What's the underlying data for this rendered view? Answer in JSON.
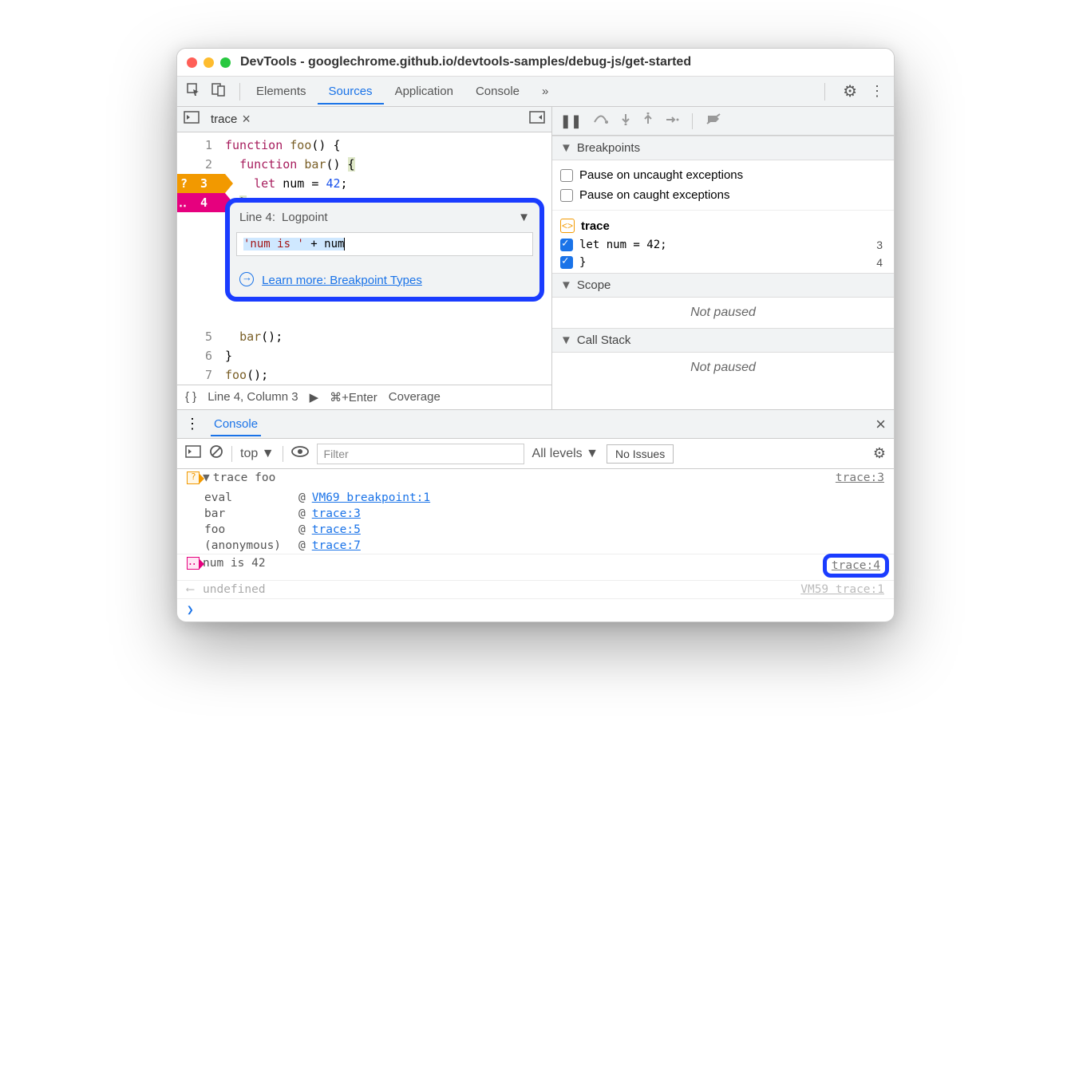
{
  "title": "DevTools - googlechrome.github.io/devtools-samples/debug-js/get-started",
  "tabs": {
    "t0": "Elements",
    "t1": "Sources",
    "t2": "Application",
    "t3": "Console"
  },
  "file_tab": "trace",
  "code": {
    "l1": "function foo() {",
    "l2": "  function bar() {",
    "l3": "    let num = 42;",
    "l4": "  }",
    "l5": "  bar();",
    "l6": "}",
    "l7": "foo();"
  },
  "ln": {
    "n1": "1",
    "n2": "2",
    "n3": "3",
    "n4": "4",
    "n5": "5",
    "n6": "6",
    "n7": "7"
  },
  "popover": {
    "line_label": "Line 4:",
    "type": "Logpoint",
    "expr_str": "'num is '",
    "expr_rest": " + num",
    "learn": "Learn more: Breakpoint Types"
  },
  "status": {
    "pos": "Line 4, Column 3",
    "run": "⌘+Enter",
    "cov": "Coverage"
  },
  "sidebar": {
    "breakpoints_h": "Breakpoints",
    "pause_uncaught": "Pause on uncaught exceptions",
    "pause_caught": "Pause on caught exceptions",
    "file": "trace",
    "bp1": "let num = 42;",
    "bp1_ln": "3",
    "bp2": "}",
    "bp2_ln": "4",
    "scope_h": "Scope",
    "callstack_h": "Call Stack",
    "not_paused": "Not paused"
  },
  "console": {
    "tab": "Console",
    "top": "top",
    "filter_ph": "Filter",
    "levels": "All levels",
    "issues": "No Issues",
    "trace_label": "trace foo",
    "trace_src": "trace:3",
    "stack": {
      "r1f": "eval",
      "r1l": "VM69 breakpoint:1",
      "r2f": "bar",
      "r2l": "trace:3",
      "r3f": "foo",
      "r3l": "trace:5",
      "r4f": "(anonymous)",
      "r4l": "trace:7"
    },
    "log_msg": "num is 42",
    "log_src": "trace:4",
    "undef": "undefined",
    "undef_src": "VM59 trace:1"
  }
}
